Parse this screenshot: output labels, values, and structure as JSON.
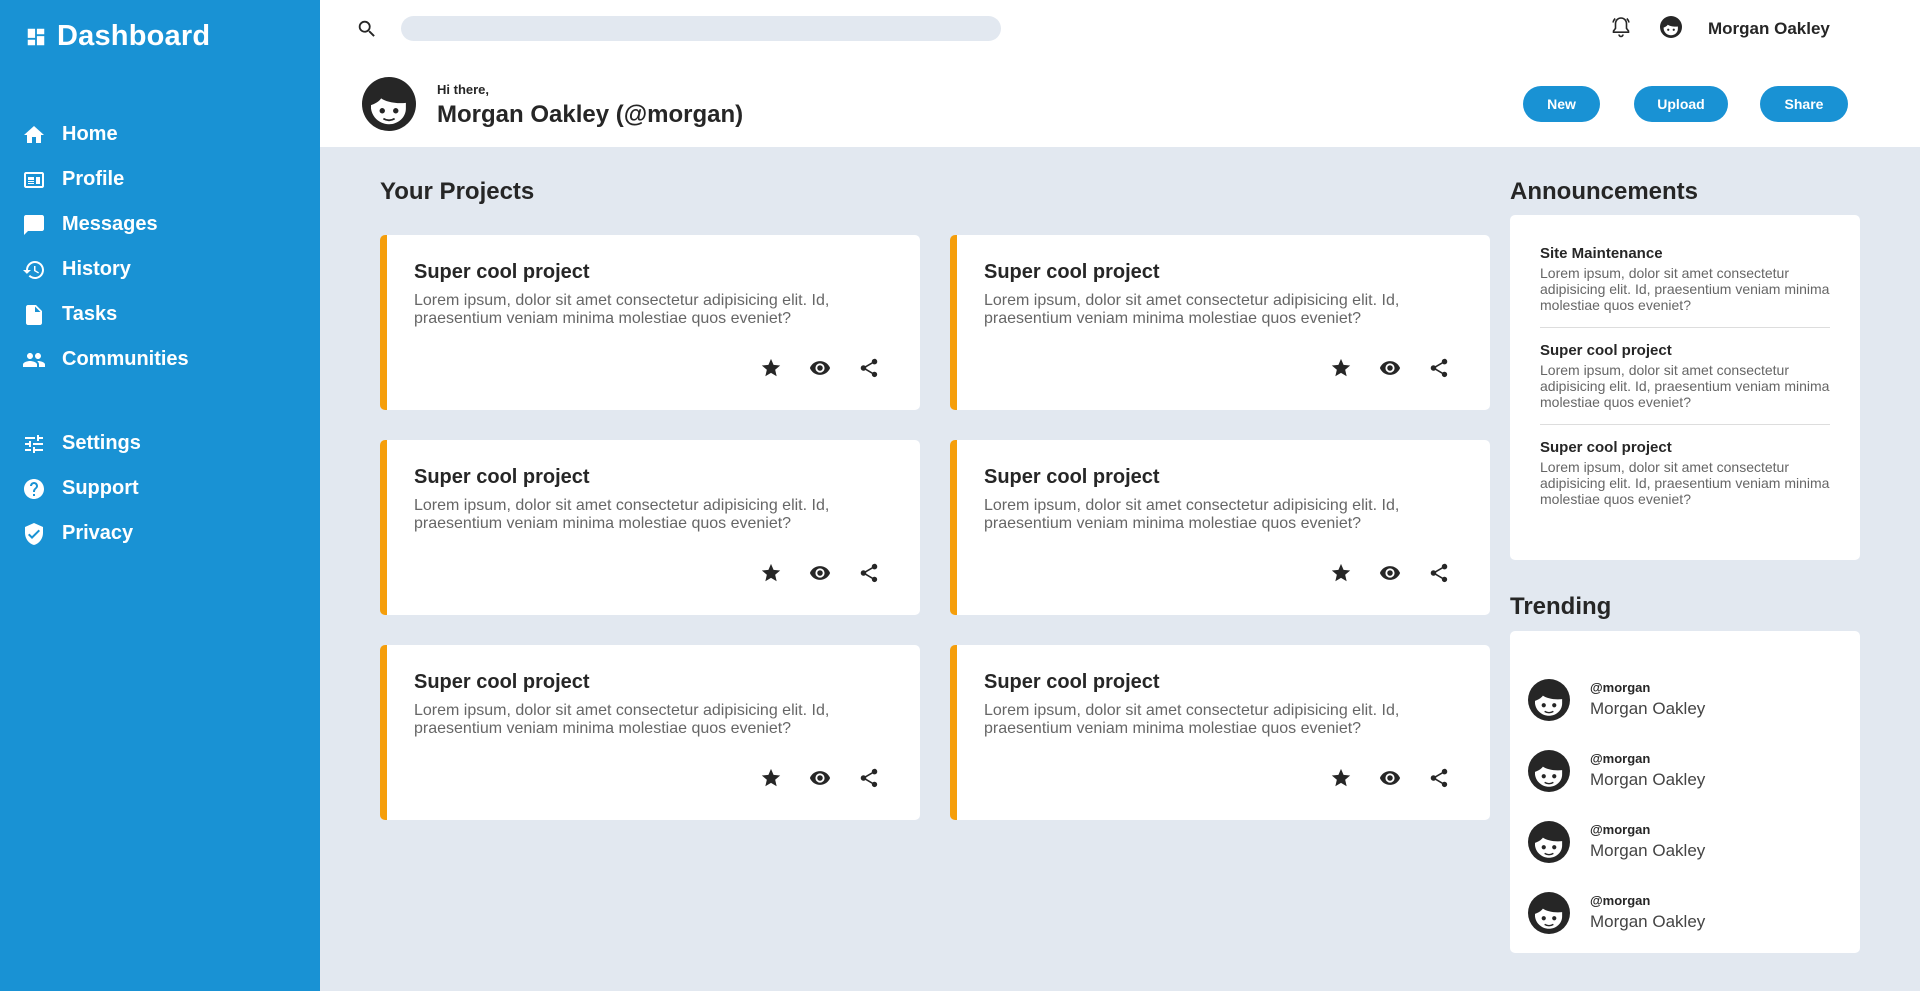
{
  "app": {
    "title": "Dashboard"
  },
  "sidebar": {
    "primary": [
      {
        "label": "Home",
        "icon": "home-icon"
      },
      {
        "label": "Profile",
        "icon": "id-card-icon"
      },
      {
        "label": "Messages",
        "icon": "chat-icon"
      },
      {
        "label": "History",
        "icon": "history-icon"
      },
      {
        "label": "Tasks",
        "icon": "document-icon"
      },
      {
        "label": "Communities",
        "icon": "people-icon"
      }
    ],
    "secondary": [
      {
        "label": "Settings",
        "icon": "sliders-icon"
      },
      {
        "label": "Support",
        "icon": "help-icon"
      },
      {
        "label": "Privacy",
        "icon": "shield-icon"
      }
    ]
  },
  "header": {
    "search": {
      "value": "",
      "placeholder": ""
    },
    "username": "Morgan Oakley",
    "greeting": "Hi there,",
    "display_name": "Morgan Oakley (@morgan)",
    "buttons": {
      "new": "New",
      "upload": "Upload",
      "share": "Share"
    }
  },
  "projects": {
    "title": "Your Projects",
    "items": [
      {
        "title": "Super cool project",
        "description": "Lorem ipsum, dolor sit amet consectetur adipisicing elit. Id, praesentium veniam minima molestiae quos eveniet?"
      },
      {
        "title": "Super cool project",
        "description": "Lorem ipsum, dolor sit amet consectetur adipisicing elit. Id, praesentium veniam minima molestiae quos eveniet?"
      },
      {
        "title": "Super cool project",
        "description": "Lorem ipsum, dolor sit amet consectetur adipisicing elit. Id, praesentium veniam minima molestiae quos eveniet?"
      },
      {
        "title": "Super cool project",
        "description": "Lorem ipsum, dolor sit amet consectetur adipisicing elit. Id, praesentium veniam minima molestiae quos eveniet?"
      },
      {
        "title": "Super cool project",
        "description": "Lorem ipsum, dolor sit amet consectetur adipisicing elit. Id, praesentium veniam minima molestiae quos eveniet?"
      },
      {
        "title": "Super cool project",
        "description": "Lorem ipsum, dolor sit amet consectetur adipisicing elit. Id, praesentium veniam minima molestiae quos eveniet?"
      }
    ]
  },
  "announcements": {
    "title": "Announcements",
    "items": [
      {
        "title": "Site Maintenance",
        "body": "Lorem ipsum, dolor sit amet consectetur adipisicing elit. Id, praesentium veniam minima molestiae quos eveniet?"
      },
      {
        "title": "Super cool project",
        "body": "Lorem ipsum, dolor sit amet consectetur adipisicing elit. Id, praesentium veniam minima molestiae quos eveniet?"
      },
      {
        "title": "Super cool project",
        "body": "Lorem ipsum, dolor sit amet consectetur adipisicing elit. Id, praesentium veniam minima molestiae quos eveniet?"
      }
    ]
  },
  "trending": {
    "title": "Trending",
    "items": [
      {
        "handle": "@morgan",
        "name": "Morgan Oakley"
      },
      {
        "handle": "@morgan",
        "name": "Morgan Oakley"
      },
      {
        "handle": "@morgan",
        "name": "Morgan Oakley"
      },
      {
        "handle": "@morgan",
        "name": "Morgan Oakley"
      }
    ]
  },
  "colors": {
    "brand": "#1992d4",
    "accent": "#f59e0b",
    "background": "#e2e8f0"
  }
}
